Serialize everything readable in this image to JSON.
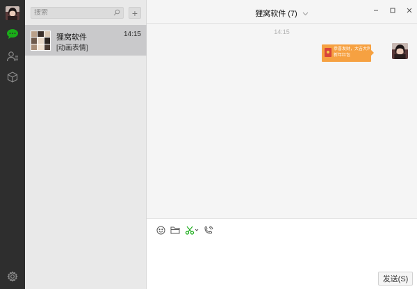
{
  "sidebar": {
    "icons": [
      "user-avatar",
      "chat-icon",
      "contacts-icon",
      "favorites-icon",
      "settings-icon"
    ],
    "active": "chat-icon",
    "accent_color": "#1aad19"
  },
  "conversations": {
    "search_placeholder": "搜索",
    "add_label": "+",
    "items": [
      {
        "name": "狸窝软件",
        "preview": "[动画表情]",
        "time": "14:15"
      }
    ]
  },
  "chat": {
    "title": "狸窝软件",
    "member_count": "(7)",
    "message_time": "14:15",
    "sticker_text": "恭喜发财，大吉大利！\n新年红包",
    "sticker_color": "#f6a141",
    "send_label": "发送(S)",
    "toolbar": [
      "emoji-icon",
      "folder-icon",
      "scissors-icon",
      "phone-icon"
    ]
  }
}
